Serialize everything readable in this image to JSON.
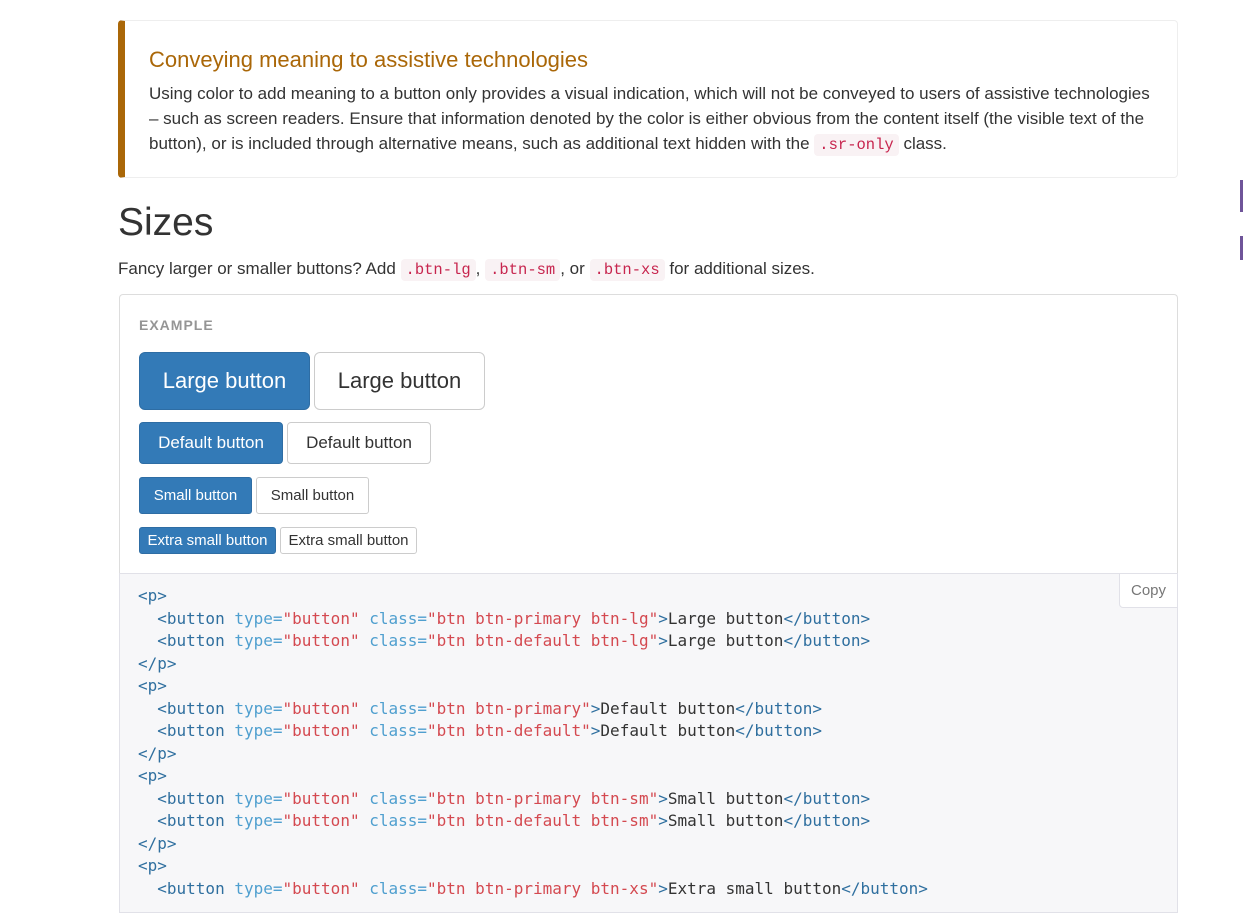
{
  "callout": {
    "title": "Conveying meaning to assistive technologies",
    "text_before_code": "Using color to add meaning to a button only provides a visual indication, which will not be conveyed to users of assistive technologies – such as screen readers. Ensure that information denoted by the color is either obvious from the content itself (the visible text of the button), or is included through alternative means, such as additional text hidden with the ",
    "code": ".sr-only",
    "text_after_code": " class."
  },
  "sizes": {
    "title": "Sizes",
    "intro_prefix": "Fancy larger or smaller buttons? Add ",
    "code_lg": ".btn-lg",
    "sep1": ", ",
    "code_sm": ".btn-sm",
    "sep2": ", or ",
    "code_xs": ".btn-xs",
    "intro_suffix": " for additional sizes."
  },
  "example": {
    "label": "EXAMPLE",
    "large_primary": "Large button",
    "large_default": "Large button",
    "default_primary": "Default button",
    "default_default": "Default button",
    "small_primary": "Small button",
    "small_default": "Small button",
    "xs_primary": "Extra small button",
    "xs_default": "Extra small button"
  },
  "code_block": {
    "copy_label": "Copy",
    "p_open": "<p>",
    "p_close": "</p>",
    "btn_open": "<button",
    "btn_close": "</button>",
    "type_attr": "type=",
    "class_attr": "class=",
    "type_val": "\"button\"",
    "gt": ">",
    "class_primary_lg": "\"btn btn-primary btn-lg\"",
    "class_default_lg": "\"btn btn-default btn-lg\"",
    "class_primary": "\"btn btn-primary\"",
    "class_default": "\"btn btn-default\"",
    "class_primary_sm": "\"btn btn-primary btn-sm\"",
    "class_default_sm": "\"btn btn-default btn-sm\"",
    "class_primary_xs": "\"btn btn-primary btn-xs\"",
    "text_large": "Large button",
    "text_default": "Default button",
    "text_small": "Small button",
    "text_xs": "Extra small button"
  },
  "colors": {
    "warning": "#aa6708",
    "primary": "#337ab7",
    "code_pink": "#c7254e",
    "tag_blue": "#2f6f9f",
    "attr_blue": "#4f9fcf",
    "string_red": "#d44950",
    "accent_purple": "#6f5499"
  }
}
